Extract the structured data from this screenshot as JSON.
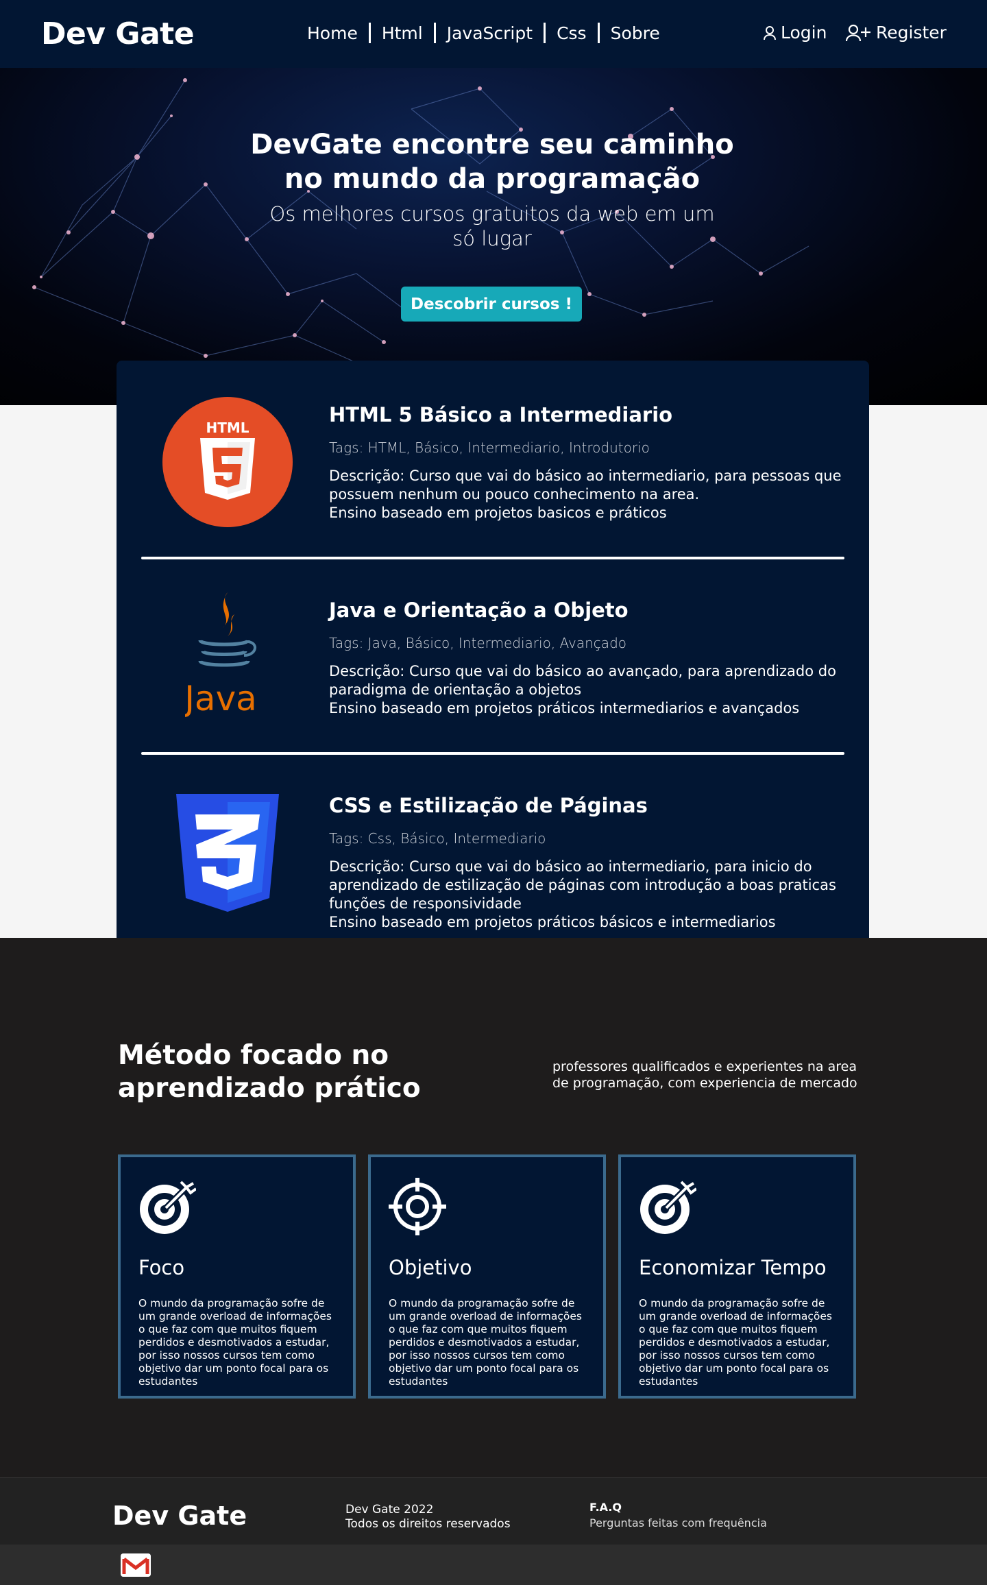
{
  "navbar": {
    "brand": "Dev Gate",
    "links": [
      "Home",
      "Html",
      "JavaScript",
      "Css",
      "Sobre"
    ],
    "login_label": "Login",
    "register_label": "Register"
  },
  "hero": {
    "title_line1": "DevGate encontre seu caminho",
    "title_line2": "no mundo da programação",
    "subtitle_line1": "Os melhores cursos gratuitos da web em um",
    "subtitle_line2": "só lugar",
    "button_label": "Descobrir cursos !"
  },
  "courses": [
    {
      "logo": "html5-logo",
      "title": "HTML 5 Básico a Intermediario",
      "tags": "Tags: HTML, Básico, Intermediario, Introdutorio",
      "desc": [
        "Descrição: Curso que vai do básico ao intermediario, para pessoas que",
        "possuem nenhum ou pouco conhecimento na area.",
        "Ensino baseado em projetos basicos e práticos"
      ]
    },
    {
      "logo": "java-logo",
      "title": "Java e Orientação a Objeto",
      "tags": "Tags: Java, Básico, Intermediario, Avançado",
      "desc": [
        "Descrição: Curso que vai do básico ao avançado, para aprendizado do",
        "paradigma de orientação a objetos",
        "Ensino baseado em projetos práticos intermediarios e avançados"
      ]
    },
    {
      "logo": "css3-logo",
      "title": "CSS e Estilização de Páginas",
      "tags": "Tags: Css, Básico, Intermediario",
      "desc": [
        "Descrição: Curso que vai do básico ao intermediario, para inicio do",
        "aprendizado de estilização de páginas com introdução a boas praticas",
        "funções de responsividade",
        "Ensino baseado em projetos práticos básicos e intermediarios"
      ]
    }
  ],
  "java_logo_text": "Java",
  "method": {
    "title_line1": "Método focado no",
    "title_line2": "aprendizado prático",
    "side_line1": "professores qualificados e experientes na area",
    "side_line2": "de programação, com experiencia de mercado",
    "cards": [
      {
        "icon": "target-arrow-icon",
        "title": "Foco",
        "text": "O mundo da programação sofre de um grande overload de informações o que faz com que muitos fiquem perdidos e desmotivados a estudar, por isso nossos cursos tem como objetivo dar um ponto focal para os estudantes"
      },
      {
        "icon": "crosshair-icon",
        "title": "Objetivo",
        "text": "O mundo da programação sofre de um grande overload de informações o que faz com que muitos fiquem perdidos e desmotivados a estudar, por isso nossos cursos tem como objetivo dar um ponto focal para os estudantes"
      },
      {
        "icon": "target-arrow-icon",
        "title": "Economizar Tempo",
        "text": "O mundo da programação sofre de um grande overload de informações o que faz com que muitos fiquem perdidos e desmotivados a estudar, por isso nossos cursos tem como objetivo dar um ponto focal para os estudantes"
      }
    ]
  },
  "footer": {
    "brand": "Dev Gate",
    "copy_line1": "Dev Gate 2022",
    "copy_line2": "Todos os direitos reservados",
    "faq_title": "F.A.Q",
    "faq_text": "Perguntas feitas com frequência",
    "social_icon": "gmail-icon"
  },
  "colors": {
    "navy": "#021633",
    "accent": "#17a9b8",
    "card_border": "#3b6a8d",
    "dark_section": "#1e1c1c"
  }
}
